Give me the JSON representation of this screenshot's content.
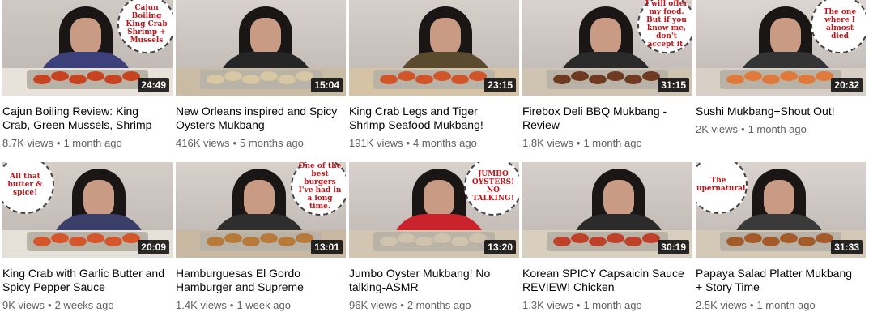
{
  "videos": [
    {
      "title": "Cajun Boiling Review: King Crab, Green Mussels, Shrimp",
      "views": "8.7K views",
      "age": "1 month ago",
      "duration": "24:49",
      "bubble": "Cajun Boiling King Crab Shrimp + Mussels",
      "wall": "#cfc8c3",
      "shirt": "#3b3f7a",
      "table": "#e8e2da",
      "food": "#c8431f"
    },
    {
      "title": "New Orleans inspired and Spicy Oysters Mukbang",
      "views": "416K views",
      "age": "5 months ago",
      "duration": "15:04",
      "bubble": "",
      "wall": "#d8d1cd",
      "shirt": "#262626",
      "table": "#c9bba4",
      "food": "#d7c7a2"
    },
    {
      "title": "King Crab Legs and Tiger Shrimp Seafood Mukbang!",
      "views": "191K views",
      "age": "4 months ago",
      "duration": "23:15",
      "bubble": "",
      "wall": "#d6cfca",
      "shirt": "#5a4a2e",
      "table": "#d6c2a4",
      "food": "#d2552a"
    },
    {
      "title": "Firebox Deli BBQ Mukbang - Review",
      "views": "1.8K views",
      "age": "1 month ago",
      "duration": "31:15",
      "bubble": "I will offer my food. But if you know me, don't accept it.",
      "wall": "#d9d2cf",
      "shirt": "#2a2a2a",
      "table": "#cfc3b2",
      "food": "#6e3b22"
    },
    {
      "title": "Sushi Mukbang+Shout Out!",
      "views": "2K views",
      "age": "1 month ago",
      "duration": "20:32",
      "bubble": "The one where I almost died",
      "wall": "#dcd5d2",
      "shirt": "#343434",
      "table": "#d8d0c6",
      "food": "#e07a3a"
    },
    {
      "title": "King Crab with Garlic Butter and Spicy Pepper Sauce",
      "views": "9K views",
      "age": "2 weeks ago",
      "duration": "20:09",
      "bubble": "All that butter & spice!",
      "wall": "#d4cdc8",
      "shirt": "#3a3f6a",
      "table": "#e6e1d8",
      "food": "#d5562b"
    },
    {
      "title": "Hamburguesas El Gordo Hamburger and Supreme",
      "views": "1.4K views",
      "age": "1 week ago",
      "duration": "13:01",
      "bubble": "One of the best burgers I've had in a long time.",
      "wall": "#d7d0cb",
      "shirt": "#2e2e2e",
      "table": "#c9b9a3",
      "food": "#b77a3a"
    },
    {
      "title": "Jumbo Oyster Mukbang! No talking-ASMR",
      "views": "96K views",
      "age": "2 months ago",
      "duration": "13:20",
      "bubble": "JUMBO OYSTERS! NO TALKING!",
      "wall": "#d8d1cd",
      "shirt": "#c9232b",
      "table": "#d2c5b1",
      "food": "#cfc3ae"
    },
    {
      "title": "Korean SPICY Capsaicin Sauce REVIEW! Chicken",
      "views": "1.3K views",
      "age": "1 month ago",
      "duration": "30:19",
      "bubble": "",
      "wall": "#d6cfcb",
      "shirt": "#2b2b2b",
      "table": "#d9cfbf",
      "food": "#c0412a"
    },
    {
      "title": "Papaya Salad Platter Mukbang + Story Time",
      "views": "2.5K views",
      "age": "1 month ago",
      "duration": "31:33",
      "bubble": "The Supernatural",
      "wall": "#dad3cf",
      "shirt": "#3a3a3a",
      "table": "#d4c8b6",
      "food": "#a35b2a"
    }
  ],
  "separator": "•"
}
